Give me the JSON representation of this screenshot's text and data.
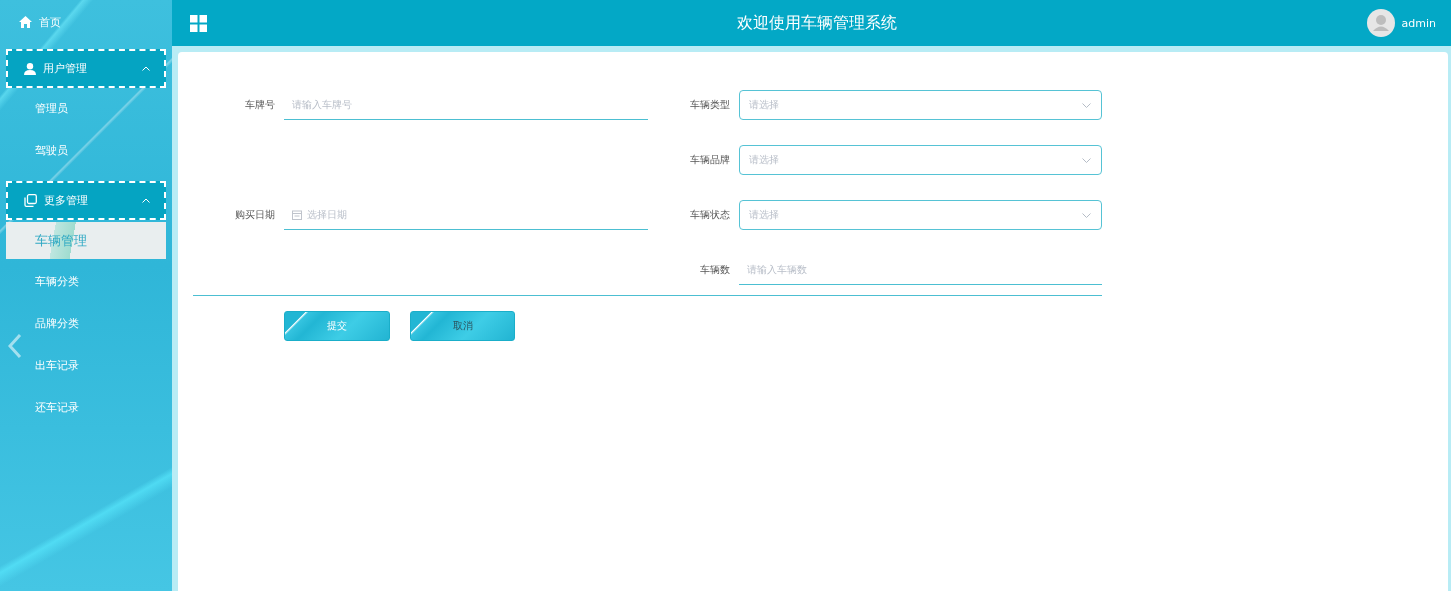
{
  "sidebar": {
    "items": [
      {
        "kind": "link",
        "label": "首页",
        "selected": false
      },
      {
        "kind": "group",
        "label": "用户管理",
        "expanded": true,
        "children": [
          {
            "label": "管理员",
            "selected": false
          },
          {
            "label": "驾驶员",
            "selected": false
          }
        ]
      },
      {
        "kind": "group",
        "label": "更多管理",
        "expanded": true,
        "children": [
          {
            "label": "车辆管理",
            "selected": true
          },
          {
            "label": "车辆分类",
            "selected": false
          },
          {
            "label": "品牌分类",
            "selected": false
          },
          {
            "label": "出车记录",
            "selected": false
          },
          {
            "label": "还车记录",
            "selected": false
          }
        ]
      }
    ]
  },
  "header": {
    "title": "欢迎使用车辆管理系统",
    "user": "admin"
  },
  "form": {
    "rows": [
      {
        "left": {
          "kind": "text",
          "label": "车牌号",
          "placeholder": "请输入车牌号"
        },
        "right": {
          "kind": "select",
          "label": "车辆类型",
          "placeholder": "请选择"
        }
      },
      {
        "right": {
          "kind": "select",
          "label": "车辆品牌",
          "placeholder": "请选择"
        }
      },
      {
        "left": {
          "kind": "date",
          "label": "购买日期",
          "placeholder": "选择日期"
        },
        "right": {
          "kind": "select",
          "label": "车辆状态",
          "placeholder": "请选择"
        }
      },
      {
        "right": {
          "kind": "text",
          "label": "车辆数",
          "placeholder": "请输入车辆数"
        }
      }
    ],
    "buttons": [
      {
        "kind": "primary",
        "label": "提交"
      },
      {
        "kind": "default",
        "label": "取消"
      }
    ]
  }
}
